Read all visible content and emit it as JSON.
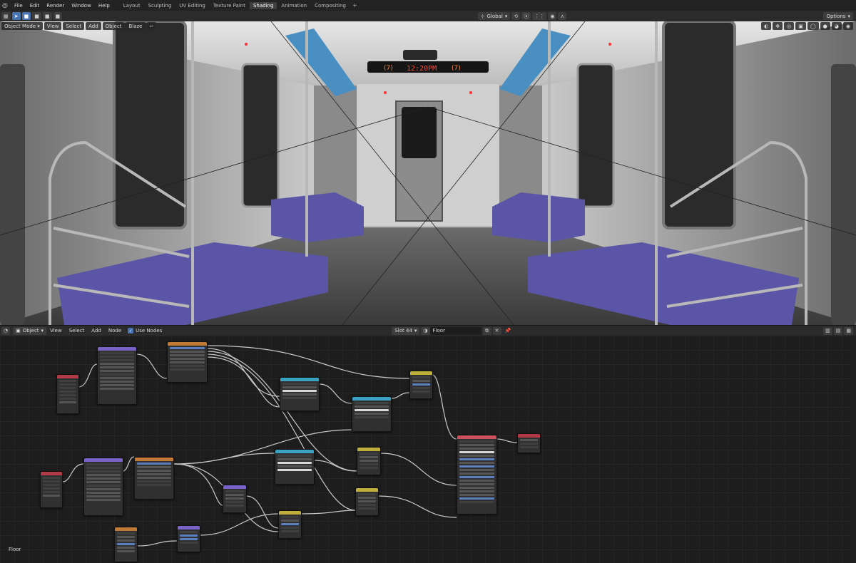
{
  "menu": {
    "logo_icon": "blender-logo-icon",
    "items": [
      "File",
      "Edit",
      "Render",
      "Window",
      "Help"
    ]
  },
  "workspaces": {
    "tabs": [
      "Layout",
      "Sculpting",
      "UV Editing",
      "Texture Paint",
      "Shading",
      "Animation",
      "Compositing"
    ],
    "active": "Shading",
    "add_label": "+"
  },
  "toolbar": {
    "transform_orientation": "Global",
    "options_label": "Options"
  },
  "viewport_header": {
    "mode": "Object Mode",
    "menus": [
      "View",
      "Select",
      "Add",
      "Object",
      "Blaze"
    ]
  },
  "viewport_scene": {
    "sign_left": "(7)",
    "sign_center": "12:20PM",
    "sign_right": "(7)"
  },
  "node_editor": {
    "object_dropdown": "Object",
    "menus": [
      "View",
      "Select",
      "Add",
      "Node"
    ],
    "use_nodes_label": "Use Nodes",
    "slot": "Slot 44",
    "material": "Floor",
    "canvas_label": "Floor"
  },
  "colors": {
    "accent": "#4772b3",
    "texture_header": "#c07a35",
    "vector_header": "#6e55b8",
    "mapping_header": "#7a62c8",
    "input_header": "#b23a48",
    "color_header": "#bfae3a",
    "shader_header": "#c9525e",
    "converter_header": "#3aa2c3",
    "output_header": "#b23a48",
    "seat": "#5a55a6"
  }
}
